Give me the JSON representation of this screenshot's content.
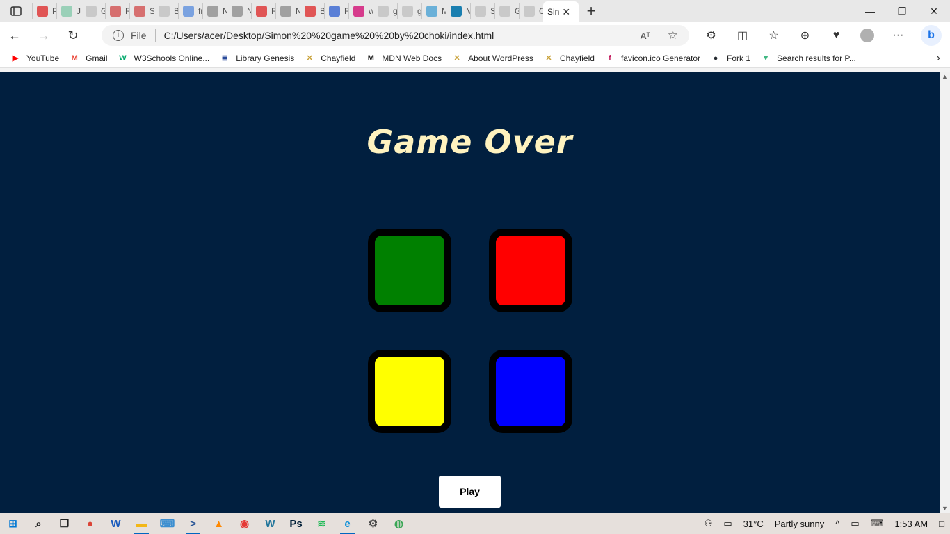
{
  "browser": {
    "tabs": [
      {
        "label": "Pe",
        "color": "#e05555"
      },
      {
        "label": "Jav",
        "color": "#9ad0b8"
      },
      {
        "label": "Gr",
        "color": "#c9c9c9"
      },
      {
        "label": "Re",
        "color": "#d66f6f"
      },
      {
        "label": "Sn",
        "color": "#d66f6f"
      },
      {
        "label": "Bla",
        "color": "#c9c9c9"
      },
      {
        "label": "fre",
        "color": "#7aa2e0"
      },
      {
        "label": "Ne",
        "color": "#a0a0a0"
      },
      {
        "label": "Ne",
        "color": "#a0a0a0"
      },
      {
        "label": "Re",
        "color": "#e05555"
      },
      {
        "label": "Ne",
        "color": "#a0a0a0"
      },
      {
        "label": "Bu",
        "color": "#e05555"
      },
      {
        "label": "Fo",
        "color": "#5a7fd6"
      },
      {
        "label": "wv",
        "color": "#d63b8c"
      },
      {
        "label": "gc",
        "color": "#c9c9c9"
      },
      {
        "label": "gc",
        "color": "#c9c9c9"
      },
      {
        "label": "Me",
        "color": "#6ab0d8"
      },
      {
        "label": "Me",
        "color": "#1a7fb0"
      },
      {
        "label": "Sh",
        "color": "#c9c9c9"
      },
      {
        "label": "Gr",
        "color": "#c9c9c9"
      },
      {
        "label": "Cc",
        "color": "#c9c9c9"
      }
    ],
    "active_tab": {
      "label": "Sin",
      "close": "✕"
    },
    "new_tab": "+",
    "window_controls": {
      "minimize": "—",
      "restore": "❐",
      "close": "✕"
    },
    "nav": {
      "back": "←",
      "forward": "→",
      "reload": "↻"
    },
    "address": {
      "info": "i",
      "scheme": "File",
      "url": "C:/Users/acer/Desktop/Simon%20%20game%20%20by%20choki/index.html",
      "read_aloud": "Aᵀ",
      "favorite": "☆"
    },
    "toolbar": {
      "extensions": "⚙",
      "split": "◫",
      "favorites": "☆",
      "collections": "⊕",
      "performance": "♥",
      "more": "···",
      "bing": "b"
    },
    "bookmarks": [
      {
        "label": "YouTube",
        "icon": "▶",
        "color": "#ff0000"
      },
      {
        "label": "Gmail",
        "icon": "M",
        "color": "#ea4335"
      },
      {
        "label": "W3Schools Online...",
        "icon": "W",
        "color": "#04aa6d"
      },
      {
        "label": "Library Genesis",
        "icon": "≣",
        "color": "#2a4a9a"
      },
      {
        "label": "Chayfield",
        "icon": "✕",
        "color": "#c9a23a"
      },
      {
        "label": "MDN Web Docs",
        "icon": "M",
        "color": "#111111"
      },
      {
        "label": "About WordPress",
        "icon": "✕",
        "color": "#c9a23a"
      },
      {
        "label": "Chayfield",
        "icon": "✕",
        "color": "#c9a23a"
      },
      {
        "label": "favicon.ico Generator",
        "icon": "f",
        "color": "#c2185b"
      },
      {
        "label": "Fork 1",
        "icon": "●",
        "color": "#24292f"
      },
      {
        "label": "Search results for P...",
        "icon": "▼",
        "color": "#41b883"
      }
    ],
    "bookmarks_more": "›"
  },
  "game": {
    "title": "Game Over",
    "play_label": "Play",
    "colors": {
      "background": "#011f3f",
      "title": "#fef2bf",
      "green": "#008000",
      "red": "#ff0000",
      "yellow": "#ffff00",
      "blue": "#0000ff"
    }
  },
  "taskbar": {
    "apps": [
      {
        "name": "start",
        "glyph": "⊞",
        "color": "#0078d4"
      },
      {
        "name": "search",
        "glyph": "⌕",
        "color": "#222222"
      },
      {
        "name": "task-view",
        "glyph": "❐",
        "color": "#222222"
      },
      {
        "name": "chrome",
        "glyph": "●",
        "color": "#db4437"
      },
      {
        "name": "word",
        "glyph": "W",
        "color": "#185abd"
      },
      {
        "name": "explorer",
        "glyph": "▬",
        "color": "#f3b716",
        "open": true
      },
      {
        "name": "keyboard",
        "glyph": "⌨",
        "color": "#3b8ed0"
      },
      {
        "name": "powershell",
        "glyph": ">",
        "color": "#2b5797",
        "open": true
      },
      {
        "name": "vlc",
        "glyph": "▲",
        "color": "#ff8800"
      },
      {
        "name": "recorder",
        "glyph": "◉",
        "color": "#e53935"
      },
      {
        "name": "wordpress",
        "glyph": "W",
        "color": "#21759b"
      },
      {
        "name": "photoshop",
        "glyph": "Ps",
        "color": "#001e36"
      },
      {
        "name": "spotify",
        "glyph": "≋",
        "color": "#1db954"
      },
      {
        "name": "edge",
        "glyph": "e",
        "color": "#0c8fd8",
        "open": true
      },
      {
        "name": "settings",
        "glyph": "⚙",
        "color": "#444444"
      },
      {
        "name": "globe",
        "glyph": "◍",
        "color": "#3aa655"
      }
    ],
    "people": "⚇",
    "weather_icon": "▭",
    "temperature": "31°C",
    "weather": "Partly sunny",
    "chevron": "^",
    "battery": "▭",
    "keyboard": "⌨",
    "time": "1:53 AM",
    "notifications": "□"
  }
}
